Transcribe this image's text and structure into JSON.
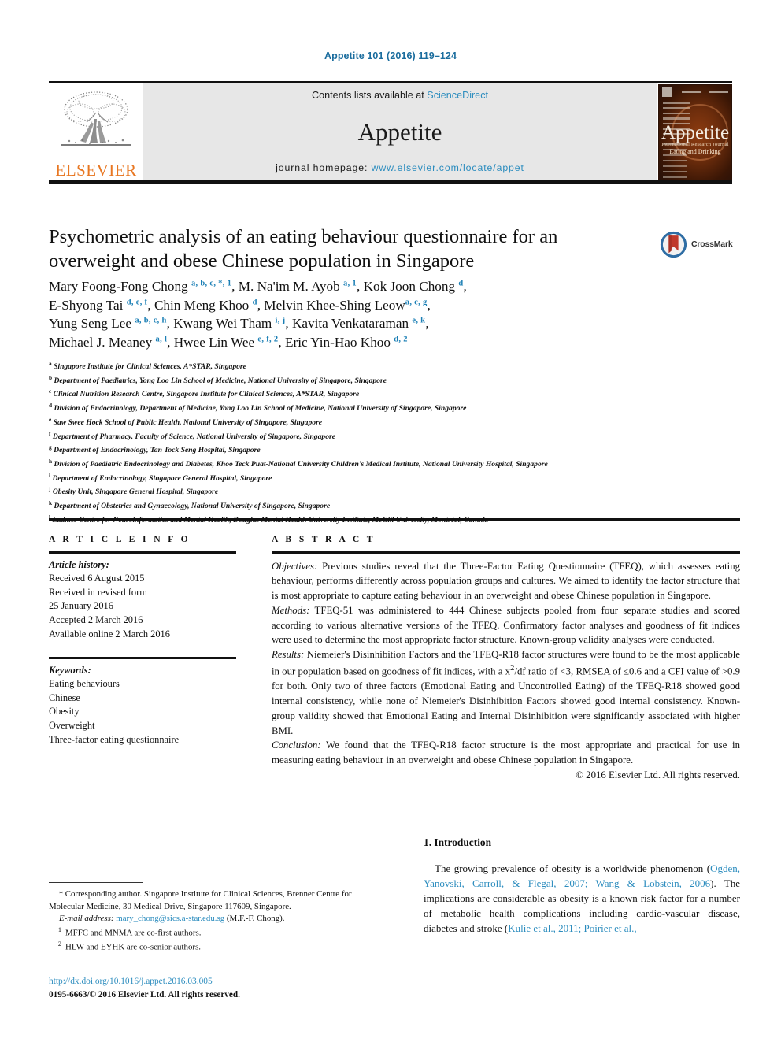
{
  "running_head": "Appetite 101 (2016) 119–124",
  "masthead": {
    "contents_prefix": "Contents lists available at ",
    "sciencedirect": "ScienceDirect",
    "journal_title": "Appetite",
    "homepage_label": "journal homepage: ",
    "homepage_url": "www.elsevier.com/locate/appet",
    "publisher": "ELSEVIER",
    "cover_title": "Appetite",
    "cover_sub": "International Research Journal",
    "cover_sub2": "Eating and Drinking"
  },
  "article": {
    "title": "Psychometric analysis of an eating behaviour questionnaire for an overweight and obese Chinese population in Singapore",
    "crossmark_label": "CrossMark"
  },
  "authors": [
    {
      "name": "Mary Foong-Fong Chong",
      "sup": "a, b, c, *, 1",
      "sep": ", "
    },
    {
      "name": "M. Na'im M. Ayob",
      "sup": "a, 1",
      "sep": ", "
    },
    {
      "name": "Kok Joon Chong",
      "sup": "d",
      "sep": ","
    },
    {
      "name": "E-Shyong Tai",
      "sup": "d, e, f",
      "sep": ", "
    },
    {
      "name": "Chin Meng Khoo",
      "sup": "d",
      "sep": ", "
    },
    {
      "name": "Melvin Khee-Shing Leow",
      "sup": "a, c, g",
      "sep": ","
    },
    {
      "name": "Yung Seng Lee",
      "sup": "a, b, c, h",
      "sep": ", "
    },
    {
      "name": "Kwang Wei Tham",
      "sup": "i, j",
      "sep": ", "
    },
    {
      "name": "Kavita Venkataraman",
      "sup": "e, k",
      "sep": ","
    },
    {
      "name": "Michael J. Meaney",
      "sup": "a, l",
      "sep": ", "
    },
    {
      "name": "Hwee Lin Wee",
      "sup": "e, f, 2",
      "sep": ", "
    },
    {
      "name": "Eric Yin-Hao Khoo",
      "sup": "d, 2",
      "sep": ""
    }
  ],
  "affiliations": [
    {
      "mark": "a",
      "text": "Singapore Institute for Clinical Sciences, A*STAR, Singapore"
    },
    {
      "mark": "b",
      "text": "Department of Paediatrics, Yong Loo Lin School of Medicine, National University of Singapore, Singapore"
    },
    {
      "mark": "c",
      "text": "Clinical Nutrition Research Centre, Singapore Institute for Clinical Sciences, A*STAR, Singapore"
    },
    {
      "mark": "d",
      "text": "Division of Endocrinology, Department of Medicine, Yong Loo Lin School of Medicine, National University of Singapore, Singapore"
    },
    {
      "mark": "e",
      "text": "Saw Swee Hock School of Public Health, National University of Singapore, Singapore"
    },
    {
      "mark": "f",
      "text": "Department of Pharmacy, Faculty of Science, National University of Singapore, Singapore"
    },
    {
      "mark": "g",
      "text": "Department of Endocrinology, Tan Tock Seng Hospital, Singapore"
    },
    {
      "mark": "h",
      "text": "Division of Paediatric Endocrinology and Diabetes, Khoo Teck Puat-National University Children's Medical Institute, National University Hospital, Singapore"
    },
    {
      "mark": "i",
      "text": "Department of Endocrinology, Singapore General Hospital, Singapore"
    },
    {
      "mark": "j",
      "text": "Obesity Unit, Singapore General Hospital, Singapore"
    },
    {
      "mark": "k",
      "text": "Department of Obstetrics and Gynaecology, National University of Singapore, Singapore"
    },
    {
      "mark": "l",
      "text": "Ludmer Centre for Neuroinformatics and Mental Health, Douglas Mental Health University Institute, McGill University, Montréal, Canada"
    }
  ],
  "article_info": {
    "heading": "A R T I C L E   I N F O",
    "history_label": "Article history:",
    "history": [
      "Received 6 August 2015",
      "Received in revised form",
      "25 January 2016",
      "Accepted 2 March 2016",
      "Available online 2 March 2016"
    ],
    "keywords_label": "Keywords:",
    "keywords": [
      "Eating behaviours",
      "Chinese",
      "Obesity",
      "Overweight",
      "Three-factor eating questionnaire"
    ]
  },
  "abstract": {
    "heading": "A B S T R A C T",
    "objectives_label": "Objectives:",
    "objectives": " Previous studies reveal that the Three-Factor Eating Questionnaire (TFEQ), which assesses eating behaviour, performs differently across population groups and cultures. We aimed to identify the factor structure that is most appropriate to capture eating behaviour in an overweight and obese Chinese population in Singapore.",
    "methods_label": "Methods:",
    "methods": " TFEQ-51 was administered to 444 Chinese subjects pooled from four separate studies and scored according to various alternative versions of the TFEQ. Confirmatory factor analyses and goodness of fit indices were used to determine the most appropriate factor structure. Known-group validity analyses were conducted.",
    "results_label": "Results:",
    "results_part1": " Niemeier's Disinhibition Factors and the TFEQ-R18 factor structures were found to be the most applicable in our population based on goodness of fit indices, with a x",
    "results_sup": "2",
    "results_part2": "/df ratio of <3, RMSEA of ≤0.6 and a CFI value of >0.9 for both. Only two of three factors (Emotional Eating and Uncontrolled Eating) of the TFEQ-R18 showed good internal consistency, while none of Niemeier's Disinhibition Factors showed good internal consistency. Known-group validity showed that Emotional Eating and Internal Disinhibition were significantly associated with higher BMI.",
    "conclusion_label": "Conclusion:",
    "conclusion": " We found that the TFEQ-R18 factor structure is the most appropriate and practical for use in measuring eating behaviour in an overweight and obese Chinese population in Singapore.",
    "copyright": "© 2016 Elsevier Ltd. All rights reserved."
  },
  "introduction": {
    "heading": "1. Introduction",
    "para_1a": "The growing prevalence of obesity is a worldwide phenomenon (",
    "cite_1": "Ogden, Yanovski, Carroll, & Flegal, 2007; Wang & Lobstein, 2006",
    "para_1b": "). The implications are considerable as obesity is a known risk factor for a number of metabolic health complications including cardio-vascular disease, diabetes and stroke (",
    "cite_2": "Kulie et al., 2011; Poirier et al.,"
  },
  "footnotes": {
    "corresponding_mark": "*",
    "corresponding": " Corresponding author. Singapore Institute for Clinical Sciences, Brenner Centre for Molecular Medicine, 30 Medical Drive, Singapore 117609, Singapore.",
    "email_label": "E-mail address:",
    "email": "mary_chong@sics.a-star.edu.sg",
    "email_owner": " (M.F.-F. Chong).",
    "note_1_num": "1",
    "note_1": "MFFC and MNMA are co-first authors.",
    "note_2_num": "2",
    "note_2": "HLW and EYHK are co-senior authors."
  },
  "publication": {
    "doi": "http://dx.doi.org/10.1016/j.appet.2016.03.005",
    "issn_line": "0195-6663/© 2016 Elsevier Ltd. All rights reserved."
  },
  "colors": {
    "link": "#2b8cbe",
    "running_head": "#1b6d9e",
    "elsevier_orange": "#e87722",
    "band_bg": "#e7e7e7"
  }
}
